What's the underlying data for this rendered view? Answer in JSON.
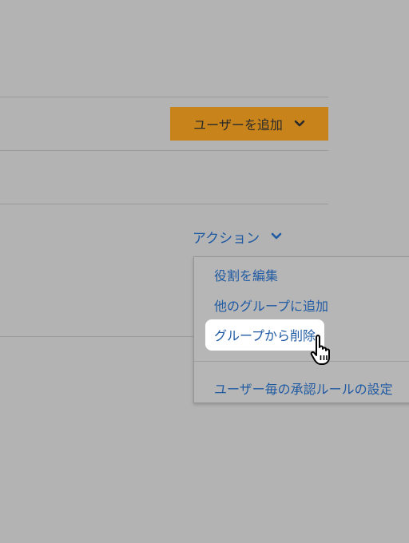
{
  "header": {
    "add_user_label": "ユーザーを追加",
    "add_user_icon": "chevron-down-icon"
  },
  "actions": {
    "label": "アクション",
    "icon": "chevron-down-icon"
  },
  "menu": {
    "items": [
      {
        "label": "役割を編集"
      },
      {
        "label": "他のグループに追加"
      },
      {
        "label": "グループから削除"
      },
      {
        "label": "ユーザー毎の承認ルールの設定"
      }
    ]
  },
  "colors": {
    "background": "#b3b3b3",
    "accent_button": "#c8841b",
    "link": "#1f5aa3",
    "highlight": "#ffffff"
  }
}
